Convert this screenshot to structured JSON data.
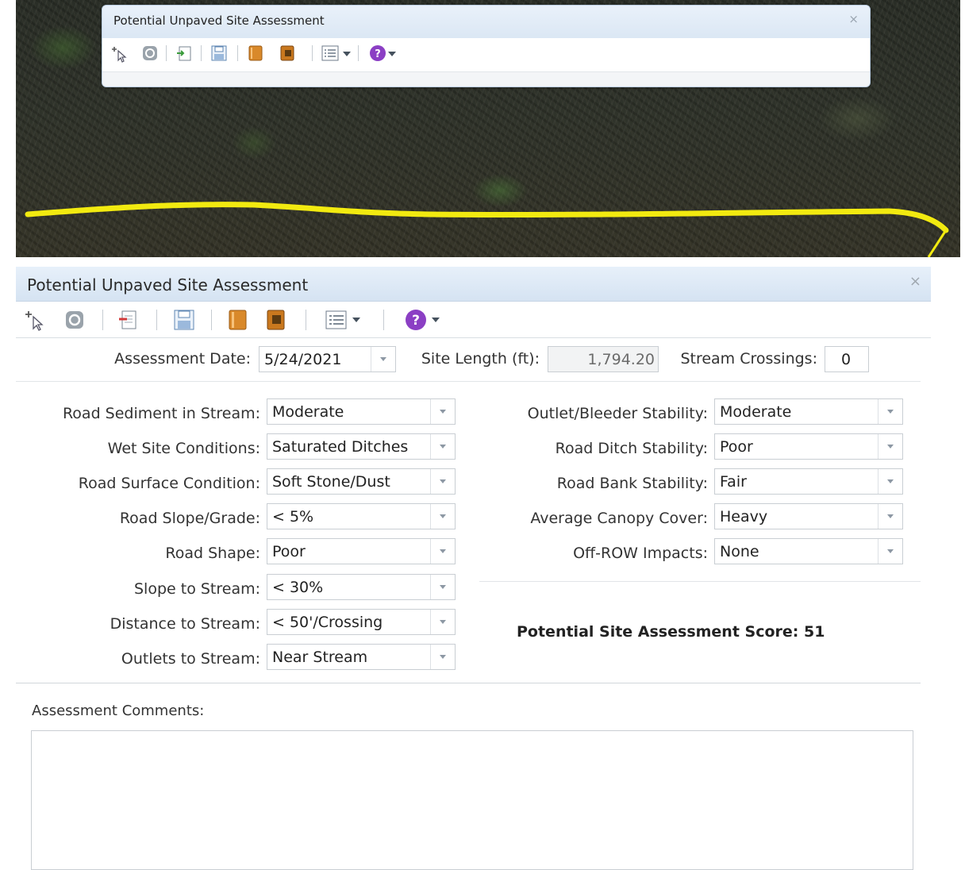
{
  "mini_window": {
    "title": "Potential Unpaved Site Assessment",
    "close_glyph": "×",
    "toolbar_icons": [
      "select-tool-icon",
      "clear-icon",
      "add-record-icon",
      "save-icon",
      "book-icon",
      "book-alt-icon",
      "list-options-icon",
      "help-icon"
    ]
  },
  "main_window": {
    "title": "Potential Unpaved Site Assessment",
    "close_glyph": "×"
  },
  "form": {
    "assessment_date_label": "Assessment Date:",
    "assessment_date_value": "5/24/2021",
    "site_length_label": "Site Length (ft):",
    "site_length_value": "1,794.20",
    "stream_crossings_label": "Stream Crossings:",
    "stream_crossings_value": "0",
    "left_fields": [
      {
        "label": "Road Sediment in Stream:",
        "value": "Moderate"
      },
      {
        "label": "Wet Site Conditions:",
        "value": "Saturated Ditches"
      },
      {
        "label": "Road Surface Condition:",
        "value": "Soft Stone/Dust"
      },
      {
        "label": "Road Slope/Grade:",
        "value": "< 5%"
      },
      {
        "label": "Road Shape:",
        "value": "Poor"
      },
      {
        "label": "Slope to Stream:",
        "value": "< 30%"
      },
      {
        "label": "Distance to Stream:",
        "value": "< 50'/Crossing"
      },
      {
        "label": "Outlets to Stream:",
        "value": "Near Stream"
      }
    ],
    "right_fields": [
      {
        "label": "Outlet/Bleeder Stability:",
        "value": "Moderate"
      },
      {
        "label": "Road Ditch Stability:",
        "value": "Poor"
      },
      {
        "label": "Road Bank Stability:",
        "value": "Fair"
      },
      {
        "label": "Average Canopy Cover:",
        "value": "Heavy"
      },
      {
        "label": "Off-ROW Impacts:",
        "value": "None"
      }
    ],
    "score_text": "Potential Site Assessment Score: 51",
    "comments_label": "Assessment Comments:",
    "comments_value": ""
  },
  "colors": {
    "road_line": "#f2ea10",
    "title_bar": "#dbe7f4",
    "help_icon": "#8b3fc4",
    "book_icon": "#d9892a"
  }
}
